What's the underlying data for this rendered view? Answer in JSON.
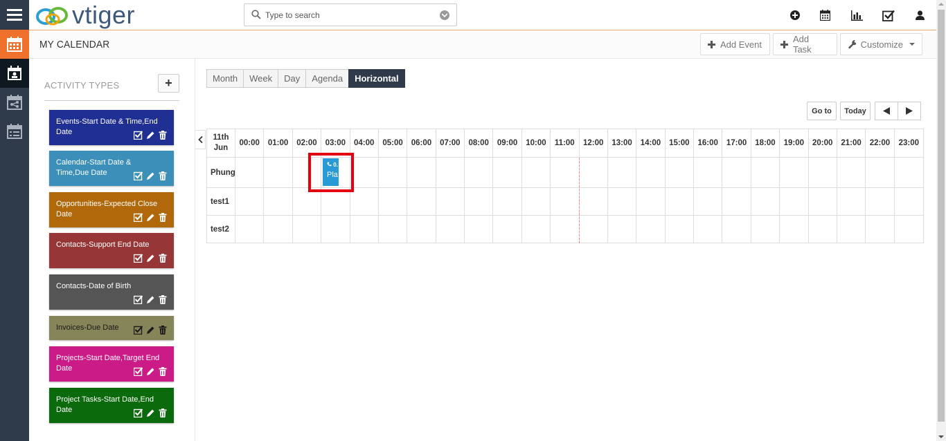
{
  "header": {
    "brand": "vtiger",
    "search_placeholder": "Type to search"
  },
  "page": {
    "title": "MY CALENDAR",
    "add_event": "Add Event",
    "add_task": "Add Task",
    "customize": "Customize"
  },
  "sidebar": {
    "title": "ACTIVITY TYPES",
    "add_label": "+",
    "items": [
      {
        "label": "Events-Start Date & Time,End Date",
        "color": "#1f2f94",
        "text_color": "#ffffff"
      },
      {
        "label": "Calendar-Start Date & Time,Due Date",
        "color": "#3b8fb8",
        "text_color": "#ffffff"
      },
      {
        "label": "Opportunities-Expected Close Date",
        "color": "#b1680a",
        "text_color": "#ffffff"
      },
      {
        "label": "Contacts-Support End Date",
        "color": "#963636",
        "text_color": "#ffffff"
      },
      {
        "label": "Contacts-Date of Birth",
        "color": "#555555",
        "text_color": "#ffffff"
      },
      {
        "label": "Invoices-Due Date",
        "color": "#858559",
        "text_color": "#1a1a1a"
      },
      {
        "label": "Projects-Start Date,Target End Date",
        "color": "#cb1b86",
        "text_color": "#ffffff"
      },
      {
        "label": "Project Tasks-Start Date,End Date",
        "color": "#0b6a0b",
        "text_color": "#ffffff"
      }
    ]
  },
  "views": [
    "Month",
    "Week",
    "Day",
    "Agenda",
    "Horizontal"
  ],
  "active_view": "Horizontal",
  "nav": {
    "goto": "Go to",
    "today": "Today"
  },
  "timeline": {
    "date_day": "11th",
    "date_month": "Jun",
    "hours": [
      "00:00",
      "01:00",
      "02:00",
      "03:00",
      "04:00",
      "05:00",
      "06:00",
      "07:00",
      "08:00",
      "09:00",
      "10:00",
      "11:00",
      "12:00",
      "13:00",
      "14:00",
      "15:00",
      "16:00",
      "17:00",
      "18:00",
      "19:00",
      "20:00",
      "21:00",
      "22:00",
      "23:00"
    ],
    "users": [
      "Phung",
      "test1",
      "test2"
    ],
    "event": {
      "time": "0.",
      "title": "Pla",
      "color": "#2a9ad6"
    }
  },
  "colors": {
    "rail": "#2f3b4a",
    "accent": "#f0712c",
    "active_view": "#2f3b4a"
  }
}
